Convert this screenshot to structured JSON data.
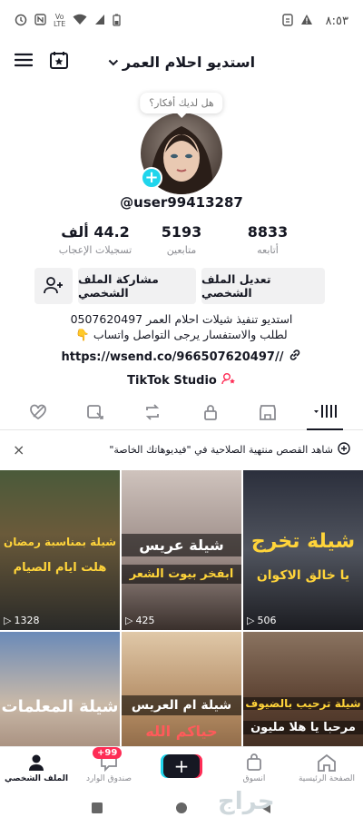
{
  "status_bar": {
    "time": "٨:٥٣",
    "lte": "LTE",
    "volte": "Vo",
    "volte2": "LTE"
  },
  "header": {
    "title": "استديو احلام العمر",
    "chevron": "⌄"
  },
  "profile": {
    "bubble_text": "هل لديك أفكار؟",
    "username": "@user99413287",
    "add_symbol": "+",
    "stats": [
      {
        "value": "8833",
        "label": "أتابعه"
      },
      {
        "value": "5193",
        "label": "متابعين"
      },
      {
        "value": "44.2 ألف",
        "label": "تسجيلات الإعجاب"
      }
    ],
    "edit_button": "تعديل الملف الشخصي",
    "share_button": "مشاركة الملف الشخصي",
    "bio_line1": "استديو تنفيذ شيلات احلام العمر 0507620497",
    "bio_line2": "لطلب والاستفسار يرجى التواصل واتساب 👇",
    "link": "https://wsend.co/966507620497//",
    "studio": "TikTok Studio"
  },
  "notice": {
    "text": "شاهد القصص منتهية الصلاحية في \"فيديوهاتك الخاصة\"",
    "close": "×"
  },
  "videos": [
    {
      "title": "",
      "subtitle": "",
      "views": "506",
      "colors": [
        "#2b2f3c",
        "#50545e"
      ]
    },
    {
      "title": "شيلة عريس",
      "subtitle": "ابفخر بيوت الشعر",
      "views": "425",
      "colors": [
        "#9a8a85",
        "#cfc3bd"
      ]
    },
    {
      "title": "شيلة بمناسبة رمضان",
      "subtitle": "هلت ايام الصيام",
      "views": "1328",
      "colors": [
        "#3a3a38",
        "#6a5a3a"
      ]
    },
    {
      "title": "شيلة ترحيب بالضيوف",
      "subtitle": "مرحبا يا هلا مليون",
      "views": "",
      "colors": [
        "#5a4030",
        "#2e2018"
      ]
    },
    {
      "title": "شيلة ام العريس",
      "subtitle": "حياكم الله",
      "views": "",
      "colors": [
        "#b08860",
        "#e0c8a8"
      ]
    },
    {
      "title": "شيلة المعلمات",
      "subtitle": "",
      "views": "",
      "colors": [
        "#6a8ab8",
        "#c9b9a8"
      ]
    }
  ],
  "video_overlays": {
    "cell1_big": "شيلة تخرج",
    "cell1_sub": "يا خالق الاكوان"
  },
  "bottom_nav": [
    {
      "label": "الصفحة الرئيسية",
      "icon": "home-icon"
    },
    {
      "label": "انسوق",
      "icon": "shop-icon"
    },
    {
      "label": "",
      "icon": "create-icon"
    },
    {
      "label": "صندوق الوارد",
      "icon": "inbox-icon",
      "badge": "99+"
    },
    {
      "label": "الملف الشخصي",
      "icon": "profile-icon"
    }
  ],
  "watermark": "حراج"
}
